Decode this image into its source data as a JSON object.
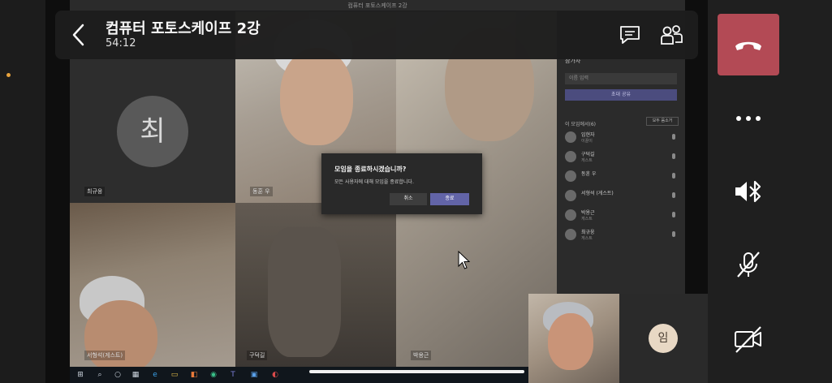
{
  "header": {
    "title": "컴퓨터 포토스케이프 2강",
    "time": "54:12"
  },
  "shared_screen": {
    "window_title": "컴퓨터 포토스케이프 2강",
    "tiles": [
      {
        "name": "최규웅",
        "avatar_letter": "최"
      },
      {
        "name": "동훈 우"
      },
      {
        "name": "서형석(게스트)"
      },
      {
        "name": "구덕길"
      },
      {
        "name": "박용근"
      }
    ],
    "panel": {
      "heading": "참가자",
      "search_placeholder": "이름 입력",
      "share_invite": "초대 공유",
      "section": "이 모임에서(6)",
      "mute_all": "모두 음소거",
      "participants": [
        {
          "name": "임현자",
          "sub": "이끌이"
        },
        {
          "name": "구덕길",
          "sub": "게스트"
        },
        {
          "name": "동훈 우",
          "sub": ""
        },
        {
          "name": "서형석 (게스트)",
          "sub": ""
        },
        {
          "name": "박용근",
          "sub": "게스트"
        },
        {
          "name": "최규웅",
          "sub": "게스트"
        }
      ]
    },
    "dialog": {
      "title": "모임을 종료하시겠습니까?",
      "message": "모든 사용자에 대해 모임을 종료합니다.",
      "cancel": "취소",
      "confirm": "종료"
    }
  },
  "self_view": {
    "avatar_letter": "임"
  },
  "colors": {
    "hangup": "#b34a55",
    "accent": "#6264a7",
    "indicator": "#e8a33d"
  },
  "icons": [
    "back-chevron-icon",
    "chat-icon",
    "people-icon",
    "phone-hangup-icon",
    "more-icon",
    "bluetooth-speaker-icon",
    "mic-off-icon",
    "camera-off-icon"
  ]
}
